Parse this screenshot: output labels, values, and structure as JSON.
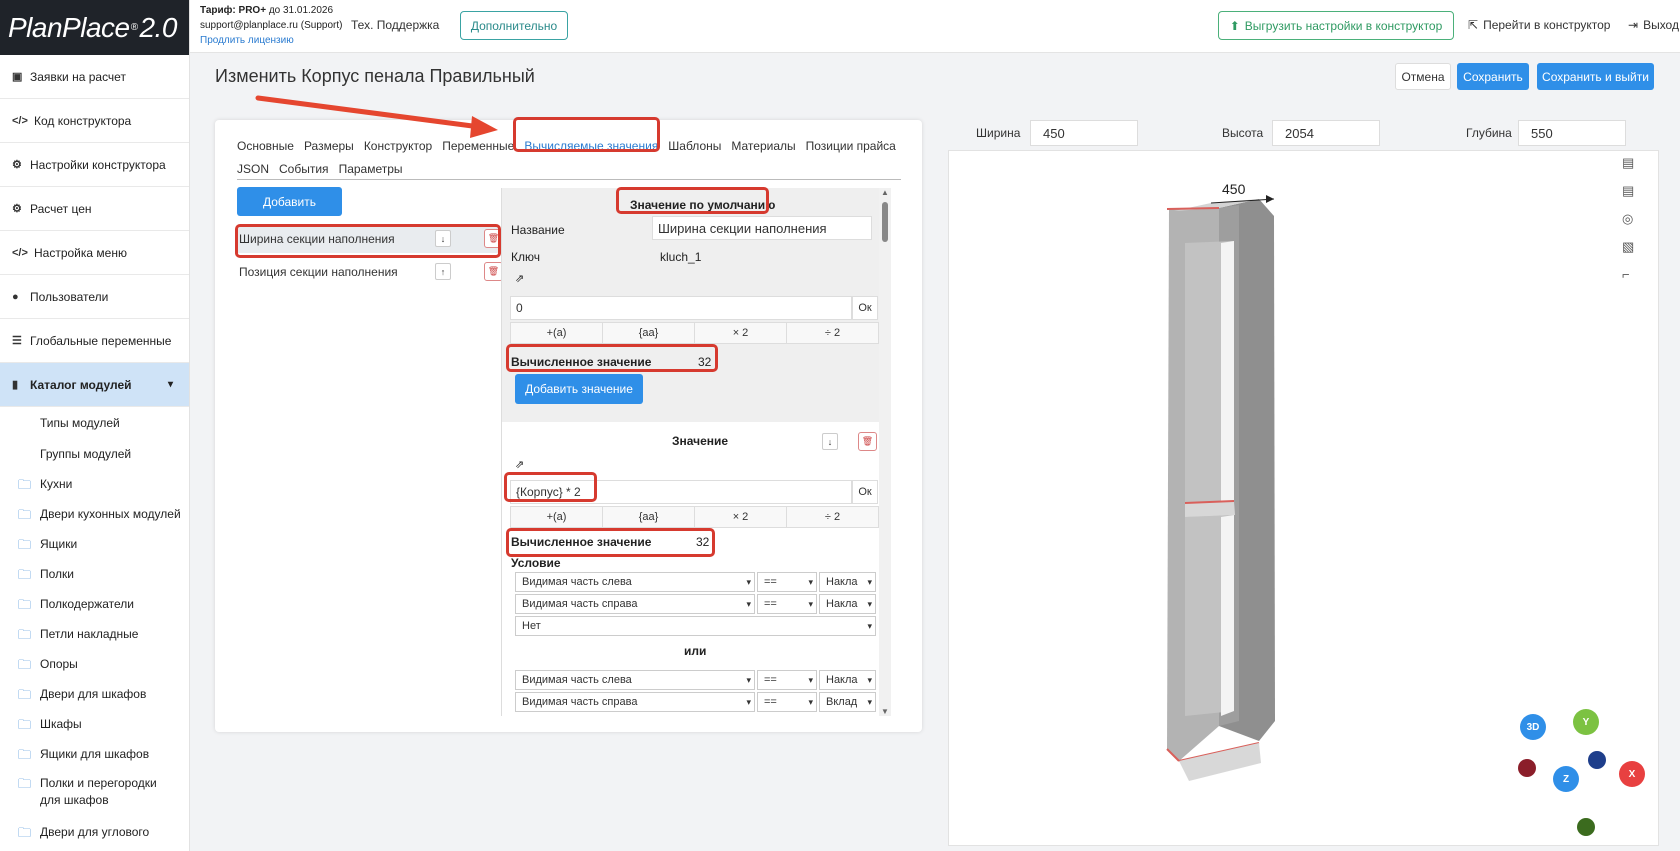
{
  "app": {
    "logo": "PlanPlace",
    "logo_mark": "®",
    "logo_version": "2.0"
  },
  "sidebar": {
    "items": [
      {
        "label": "Заявки на расчет",
        "icon": "clipboard-icon"
      },
      {
        "label": "Код конструктора",
        "icon": "code-icon"
      },
      {
        "label": "Настройки конструктора",
        "icon": "gears-icon"
      },
      {
        "label": "Расчет цен",
        "icon": "gears-icon"
      },
      {
        "label": "Настройка меню",
        "icon": "code-icon"
      },
      {
        "label": "Пользователи",
        "icon": "user-icon"
      },
      {
        "label": "Глобальные переменные",
        "icon": "list-icon"
      },
      {
        "label": "Каталог модулей",
        "icon": "book-icon"
      }
    ],
    "sub_items": [
      "Типы модулей",
      "Группы модулей"
    ],
    "folders": [
      "Кухни",
      "Двери кухонных модулей",
      "Ящики",
      "Полки",
      "Полкодержатели",
      "Петли накладные",
      "Опоры",
      "Двери для шкафов",
      "Шкафы",
      "Ящики для шкафов",
      "Полки и перегородки для шкафов",
      "Двери для углового"
    ]
  },
  "topbar": {
    "tariff_label": "Тариф: PRO+",
    "tariff_until": " до 31.01.2026",
    "email": "support@planplace.ru (Support)",
    "renew_link": "Продлить лицензию",
    "support": "Тех. Поддержка",
    "more_button": "Дополнительно",
    "export_button": "Выгрузить настройки в конструктор",
    "goto_constructor": "Перейти в конструктор",
    "logout": "Выход"
  },
  "page": {
    "title": "Изменить Корпус пенала Правильный",
    "cancel": "Отмена",
    "save": "Сохранить",
    "save_exit": "Сохранить и выйти"
  },
  "tabs": {
    "row1": [
      "Основные",
      "Размеры",
      "Конструктор",
      "Переменные",
      "Вычисляемые значения",
      "Шаблоны",
      "Материалы",
      "Позиции прайса"
    ],
    "row2": [
      "JSON",
      "События",
      "Параметры"
    ],
    "active": "Вычисляемые значения"
  },
  "editor": {
    "add_button": "Добавить",
    "variables": [
      "Ширина секции наполнения",
      "Позиция секции наполнения"
    ],
    "default_header": "Значение по умолчанию",
    "name_label": "Название",
    "name_value": "Ширина секции наполнения",
    "key_label": "Ключ",
    "key_value": "kluch_1",
    "expr_default": "0",
    "ok": "Ок",
    "ops": [
      "+(a)",
      "{aa}",
      "× 2",
      "÷ 2"
    ],
    "computed_label": "Вычисленное значение",
    "computed_default": "32",
    "add_value_button": "Добавить значение",
    "value_header": "Значение",
    "expr_value": "{Корпус} * 2",
    "computed_value": "32",
    "condition_label": "Условие",
    "or_label": "или",
    "cond1": [
      "Видимая часть слева",
      "==",
      "Накла"
    ],
    "cond2": [
      "Видимая часть справа",
      "==",
      "Накла"
    ],
    "cond3": "Нет",
    "cond4": [
      "Видимая часть слева",
      "==",
      "Накла"
    ],
    "cond5": [
      "Видимая часть справа",
      "==",
      "Вклад"
    ]
  },
  "viewer": {
    "width_label": "Ширина",
    "width_value": "450",
    "height_label": "Высота",
    "height_value": "2054",
    "depth_label": "Глубина",
    "depth_value": "550",
    "dimension_annotation": "450",
    "badge_3d": "3D",
    "axis_y": "Y",
    "axis_z": "Z",
    "axis_x": "X"
  },
  "colors": {
    "accent": "#2f8fe8",
    "highlight": "#d63a2f",
    "sidebar_active": "#cfe3f7"
  }
}
